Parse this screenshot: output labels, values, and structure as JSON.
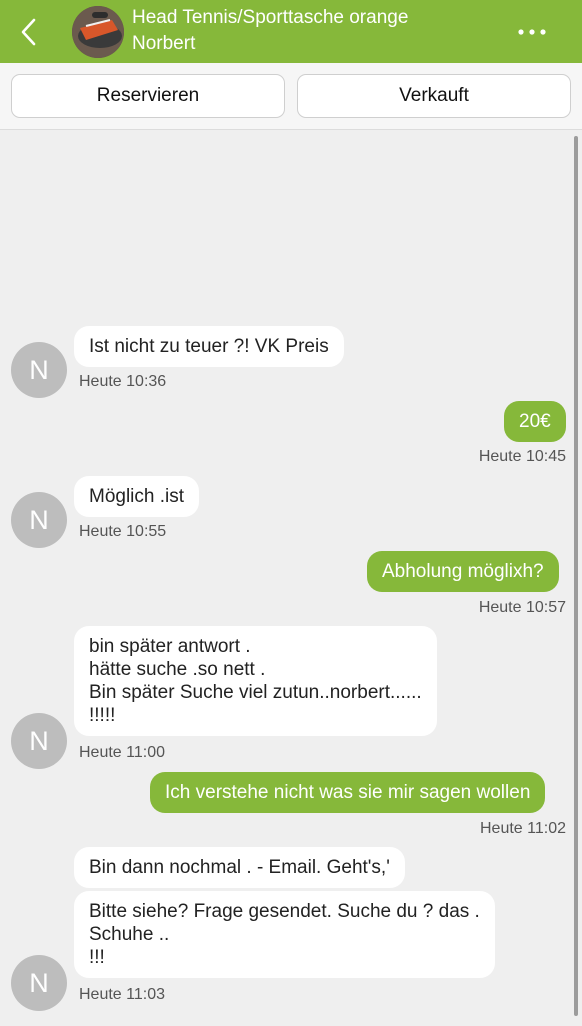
{
  "header": {
    "title": "Head Tennis/Sporttasche orange",
    "subtitle": "Norbert",
    "back_icon": "chevron-left-icon",
    "more_icon": "more-horizontal-icon",
    "bg_color": "#86b83a"
  },
  "actions": {
    "reserve_label": "Reservieren",
    "sold_label": "Verkauft"
  },
  "contact": {
    "initial": "N"
  },
  "messages": [
    {
      "dir": "in",
      "lines": [
        "Ist nicht zu teuer ?! VK Preis"
      ],
      "time": "Heute 10:36"
    },
    {
      "dir": "out",
      "lines": [
        "20€"
      ],
      "time": "Heute 10:45"
    },
    {
      "dir": "in",
      "lines": [
        "Möglich .ist"
      ],
      "time": "Heute 10:55"
    },
    {
      "dir": "out",
      "lines": [
        "Abholung möglixh?"
      ],
      "time": "Heute 10:57"
    },
    {
      "dir": "in",
      "lines": [
        "bin später antwort .",
        "hätte suche .so nett .",
        "Bin später Suche viel zutun..norbert......",
        "!!!!!"
      ],
      "time": "Heute 11:00"
    },
    {
      "dir": "out",
      "lines": [
        "Ich verstehe nicht was sie mir sagen wollen"
      ],
      "time": "Heute 11:02"
    },
    {
      "dir": "in",
      "lines": [
        "Bin dann nochmal . - Email.   Geht's,'"
      ]
    },
    {
      "dir": "in",
      "lines": [
        "Bitte siehe? Frage gesendet.  Suche du ? das .",
        "Schuhe ..",
        "!!!"
      ],
      "time": "Heute 11:03"
    }
  ]
}
